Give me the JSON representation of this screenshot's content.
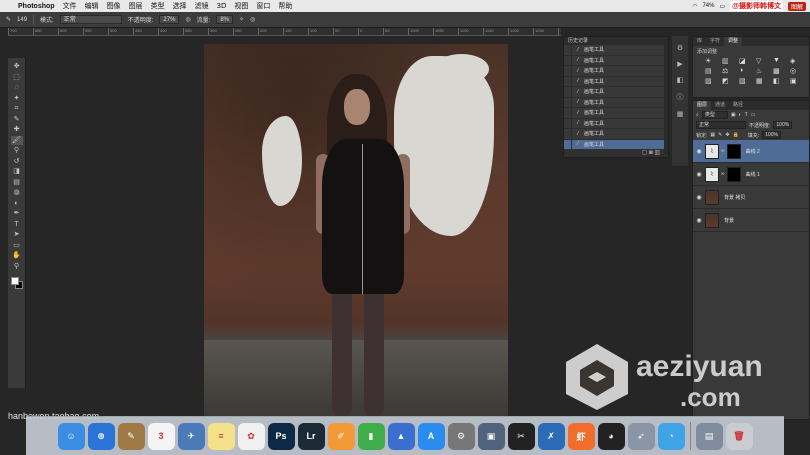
{
  "menubar": {
    "app_name": "Photoshop",
    "items": [
      "文件",
      "编辑",
      "图像",
      "图层",
      "类型",
      "选择",
      "滤镜",
      "3D",
      "视图",
      "窗口",
      "帮助"
    ],
    "battery": "74%",
    "watermark": "@摄影师韩博文",
    "badge": "图解"
  },
  "options_bar": {
    "brush_size": "149",
    "mode_label": "模式:",
    "mode_value": "正常",
    "opacity_label": "不透明度:",
    "opacity_value": "27%",
    "flow_label": "流量:",
    "flow_value": "8%"
  },
  "ruler": {
    "ticks": [
      "700",
      "650",
      "600",
      "550",
      "500",
      "450",
      "400",
      "350",
      "300",
      "250",
      "200",
      "150",
      "100",
      "50",
      "0",
      "50",
      "1000",
      "1050",
      "1100",
      "1150",
      "1200",
      "1250",
      "1300",
      "1350"
    ]
  },
  "toolbar": {
    "tools": [
      "move-tool",
      "marquee-tool",
      "lasso-tool",
      "magic-wand-tool",
      "crop-tool",
      "eyedropper-tool",
      "healing-tool",
      "brush-tool",
      "stamp-tool",
      "history-brush-tool",
      "eraser-tool",
      "gradient-tool",
      "blur-tool",
      "dodge-tool",
      "pen-tool",
      "type-tool",
      "path-select-tool",
      "shape-tool",
      "hand-tool",
      "zoom-tool"
    ],
    "glyphs": [
      "✥",
      "⬚",
      "◌",
      "✦",
      "⌗",
      "✎",
      "✚",
      "🖌",
      "⚲",
      "↺",
      "◨",
      "▤",
      "◍",
      "◐",
      "✒",
      "T",
      "➤",
      "▭",
      "✋",
      "⚲"
    ]
  },
  "history": {
    "tab": "历史记录",
    "items": [
      "画笔工具",
      "画笔工具",
      "画笔工具",
      "画笔工具",
      "画笔工具",
      "画笔工具",
      "画笔工具",
      "画笔工具",
      "画笔工具",
      "画笔工具"
    ]
  },
  "adjustments": {
    "tabs": [
      "库",
      "字符",
      "调整"
    ],
    "title": "添加调整",
    "icons": [
      "☀",
      "▥",
      "◪",
      "▽",
      "▼",
      "◈",
      "▤",
      "⚖",
      "◑",
      "♨",
      "▩",
      "◎",
      "▨",
      "◩",
      "▧",
      "▦",
      "◧",
      "▣"
    ]
  },
  "layers": {
    "tabs": [
      "图层",
      "通道",
      "路径"
    ],
    "kind_label": "类型",
    "blend_mode": "正常",
    "opacity_label": "不透明度:",
    "opacity_value": "100%",
    "lock_label": "锁定:",
    "fill_label": "填充:",
    "fill_value": "100%",
    "items": [
      {
        "name": "曲线 2",
        "type": "adjustment"
      },
      {
        "name": "曲线 1",
        "type": "adjustment"
      },
      {
        "name": "背景 拷贝",
        "type": "photo"
      },
      {
        "name": "背景",
        "type": "photo"
      }
    ]
  },
  "dock": {
    "apps": [
      {
        "name": "finder",
        "label": "☺",
        "color": "#3b8de3"
      },
      {
        "name": "safari",
        "label": "⊕",
        "color": "#2a74d8"
      },
      {
        "name": "notes-brown",
        "label": "✎",
        "color": "#a07a44"
      },
      {
        "name": "calendar",
        "label": "3",
        "color": "#f4f4f4"
      },
      {
        "name": "preview",
        "label": "✈",
        "color": "#4a7bb8"
      },
      {
        "name": "notes",
        "label": "≡",
        "color": "#f3e28a"
      },
      {
        "name": "photos",
        "label": "✿",
        "color": "#f0f0f0"
      },
      {
        "name": "photoshop",
        "label": "Ps",
        "color": "#0c2a45"
      },
      {
        "name": "lightroom",
        "label": "Lr",
        "color": "#1c2a35"
      },
      {
        "name": "pages",
        "label": "✐",
        "color": "#f29a36"
      },
      {
        "name": "numbers",
        "label": "▮",
        "color": "#3fae4a"
      },
      {
        "name": "keynote",
        "label": "▲",
        "color": "#3a6fcf"
      },
      {
        "name": "app-store",
        "label": "A",
        "color": "#2b8cf0"
      },
      {
        "name": "system-preferences",
        "label": "⚙",
        "color": "#777"
      },
      {
        "name": "image-capture",
        "label": "▣",
        "color": "#50637d"
      },
      {
        "name": "final-cut",
        "label": "✂",
        "color": "#222"
      },
      {
        "name": "xcode",
        "label": "✗",
        "color": "#2c6bb7"
      },
      {
        "name": "xiami",
        "label": "虾",
        "color": "#f26c2b"
      },
      {
        "name": "qq",
        "label": "◕",
        "color": "#222"
      },
      {
        "name": "launchpad",
        "label": "➶",
        "color": "#8a96a8"
      },
      {
        "name": "qq-browser",
        "label": "◔",
        "color": "#3fa3e8"
      },
      {
        "name": "downloads",
        "label": "▤",
        "color": "#7f8c9c"
      },
      {
        "name": "trash",
        "label": "🗑",
        "color": "#c9ccd0"
      }
    ],
    "notification_badge": "1"
  },
  "watermarks": {
    "bottom_left": "hanbowen.taobao.com",
    "brand_line1": "aeziyuan",
    "brand_line2": ".com"
  }
}
